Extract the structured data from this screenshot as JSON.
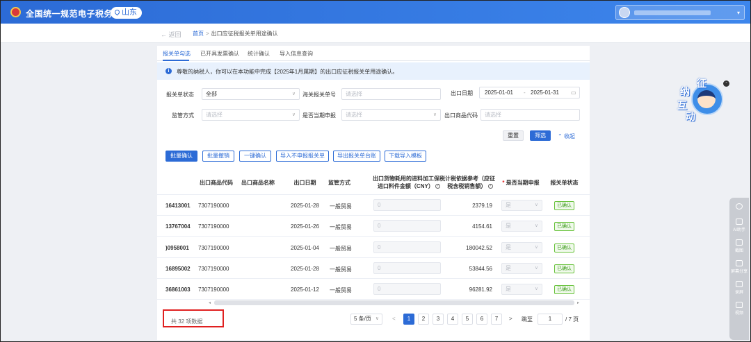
{
  "header": {
    "title": "全国统一规范电子税务局",
    "region": "山东"
  },
  "breadcrumb": {
    "back": "返回",
    "home": "首页",
    "separator": ">",
    "current": "出口应征税报关单用途确认"
  },
  "tabs": [
    {
      "label": "报关单勾选",
      "active": true
    },
    {
      "label": "已开具发票确认",
      "active": false
    },
    {
      "label": "统计确认",
      "active": false
    },
    {
      "label": "导入信息查询",
      "active": false
    }
  ],
  "notice": {
    "icon": "info-icon",
    "text": "尊敬的纳税人，你可以在本功能中完成【2025年1月属期】的出口应征税报关单用途确认。"
  },
  "filters": {
    "status_label": "报关单状态",
    "status_value": "全部",
    "customs_no_label": "海关报关单号",
    "customs_no_placeholder": "请选择",
    "export_date_label": "出口日期",
    "date_start": "2025-01-01",
    "date_sep": "-",
    "date_end": "2025-01-31",
    "supervision_label": "监管方式",
    "supervision_placeholder": "请选择",
    "period_label": "是否当期申报",
    "period_placeholder": "请选择",
    "goods_code_label": "出口商品代码",
    "goods_code_placeholder": "请选择",
    "reset": "重置",
    "filter": "筛选",
    "collapse": "收起"
  },
  "actions": [
    {
      "label": "批量确认",
      "primary": true
    },
    {
      "label": "批量撤销",
      "primary": false
    },
    {
      "label": "一键确认",
      "primary": false
    },
    {
      "label": "导入不申报报关单",
      "primary": false
    },
    {
      "label": "导出报关单台账",
      "primary": false
    },
    {
      "label": "下载导入模板",
      "primary": false
    }
  ],
  "table": {
    "columns": {
      "goods_code": "出口商品代码",
      "goods_name": "出口商品名称",
      "export_date": "出口日期",
      "supervision": "监管方式",
      "material_amount_line1": "出口货物耗用的进料加工保税",
      "material_amount_line2": "进口料件金额（CNY）",
      "tax_ref_line1": "计税依据参考（应征",
      "tax_ref_line2": "税含税销售额）",
      "required_mark": "*",
      "current_period": "是否当期申报",
      "status": "报关单状态"
    },
    "rows": [
      {
        "no": "16413001",
        "goods_code": "7307190000",
        "goods_name": "",
        "export_date": "2025-01-28",
        "supervision": "一般贸易",
        "material_amount": "0",
        "tax_ref": "2379.19",
        "current_period": "是",
        "status": "已确认"
      },
      {
        "no": "13767004",
        "goods_code": "7307190000",
        "goods_name": "",
        "export_date": "2025-01-26",
        "supervision": "一般贸易",
        "material_amount": "0",
        "tax_ref": "4154.61",
        "current_period": "是",
        "status": "已确认"
      },
      {
        "no": ")0958001",
        "goods_code": "7307190000",
        "goods_name": "",
        "export_date": "2025-01-04",
        "supervision": "一般贸易",
        "material_amount": "0",
        "tax_ref": "180042.52",
        "current_period": "是",
        "status": "已确认"
      },
      {
        "no": "16895002",
        "goods_code": "7307190000",
        "goods_name": "",
        "export_date": "2025-01-28",
        "supervision": "一般贸易",
        "material_amount": "0",
        "tax_ref": "53844.56",
        "current_period": "是",
        "status": "已确认"
      },
      {
        "no": "36861003",
        "goods_code": "7307190000",
        "goods_name": "",
        "export_date": "2025-01-12",
        "supervision": "一般贸易",
        "material_amount": "0",
        "tax_ref": "96281.92",
        "current_period": "是",
        "status": "已确认"
      }
    ]
  },
  "pagination": {
    "total": "共 32 项数据",
    "page_size": "5 条/页",
    "prev": "<",
    "next": ">",
    "pages": [
      "1",
      "2",
      "3",
      "4",
      "5",
      "6",
      "7"
    ],
    "current": "1",
    "jump_label": "跳至",
    "jump_value": "1",
    "total_pages": "/ 7 页"
  },
  "mascot": {
    "chars": [
      "纳",
      "征",
      "互",
      "动"
    ],
    "close": "-"
  },
  "side_tools": [
    "AI助手",
    "截图",
    "屏幕分享",
    "录屏",
    "视频"
  ],
  "colors": {
    "primary": "#2c6bd6",
    "header": "#3d86ec",
    "confirmed_tag": "#3a9b18",
    "highlight_border": "#e02020"
  }
}
